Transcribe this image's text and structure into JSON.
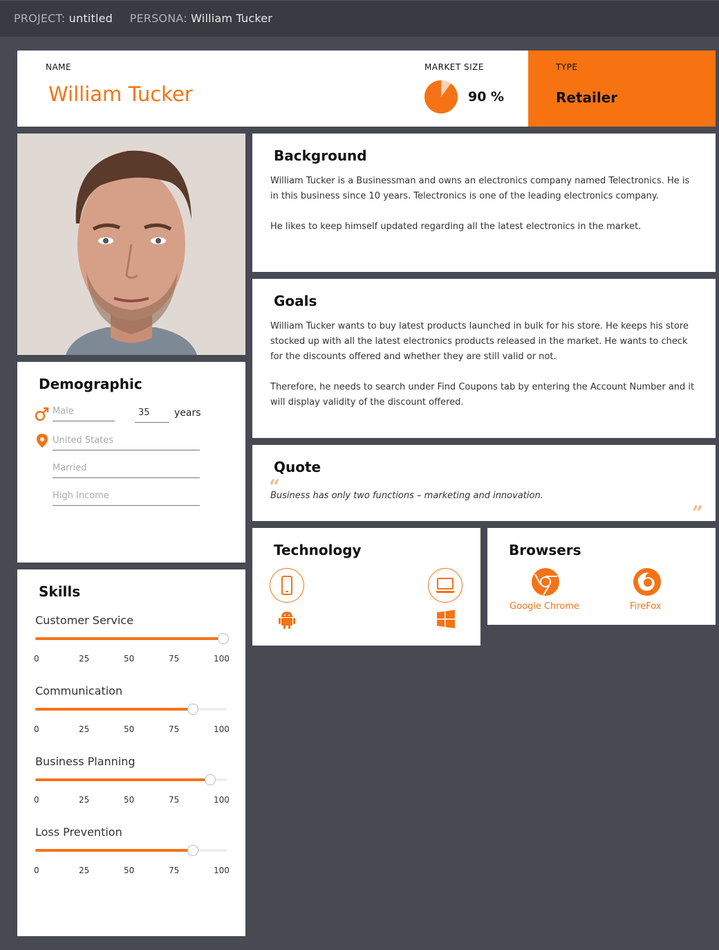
{
  "topbar": {
    "project_label": "PROJECT:",
    "project_value": "untitled",
    "persona_label": "PERSONA:",
    "persona_value": "William Tucker"
  },
  "header": {
    "name_label": "NAME",
    "name_value": "William Tucker",
    "market_size_label": "MARKET SIZE",
    "market_size_value": "90 %",
    "market_size_fraction": 0.9,
    "type_label": "TYPE",
    "type_value": "Retailer"
  },
  "background": {
    "title": "Background",
    "p1": "William Tucker is a  Businessman and owns an electronics company named Telectronics. He is in this business since 10 years. Telectronics is one of the leading electronics company.",
    "p2": "He likes to keep himself updated regarding all the latest electronics in the market."
  },
  "goals": {
    "title": "Goals",
    "p1": "William Tucker wants to buy latest products launched in bulk for his store. He keeps his store stocked up with all the latest electronics products released in the  market. He wants to check for the discounts offered and whether they are still valid or not.",
    "p2": "Therefore, he needs to search under Find Coupons  tab by entering the Account Number and it will display validity of the discount offered."
  },
  "quote": {
    "title": "Quote",
    "text": "Business has only two functions – marketing and innovation."
  },
  "technology": {
    "title": "Technology",
    "icons": [
      "mobile-icon",
      "laptop-icon",
      "android-icon",
      "windows-icon"
    ]
  },
  "browsers": {
    "title": "Browsers",
    "items": [
      "Google Chrome",
      "FireFox"
    ],
    "icons": [
      "chrome-icon",
      "firefox-icon"
    ]
  },
  "demographic": {
    "title": "Demographic",
    "gender_placeholder": "Male",
    "age_value": "35",
    "age_unit": "years",
    "location_placeholder": "United States",
    "marital_placeholder": "Married",
    "income_placeholder": "High Income"
  },
  "skills": {
    "title": "Skills",
    "ticks": [
      "0",
      "25",
      "50",
      "75",
      "100"
    ],
    "items": [
      {
        "name": "Customer Service",
        "value": 100
      },
      {
        "name": "Communication",
        "value": 84
      },
      {
        "name": "Business Planning",
        "value": 93
      },
      {
        "name": "Loss Prevention",
        "value": 84
      }
    ]
  },
  "colors": {
    "accent": "#f57316",
    "background": "#474a52",
    "topbar": "#383b42"
  }
}
